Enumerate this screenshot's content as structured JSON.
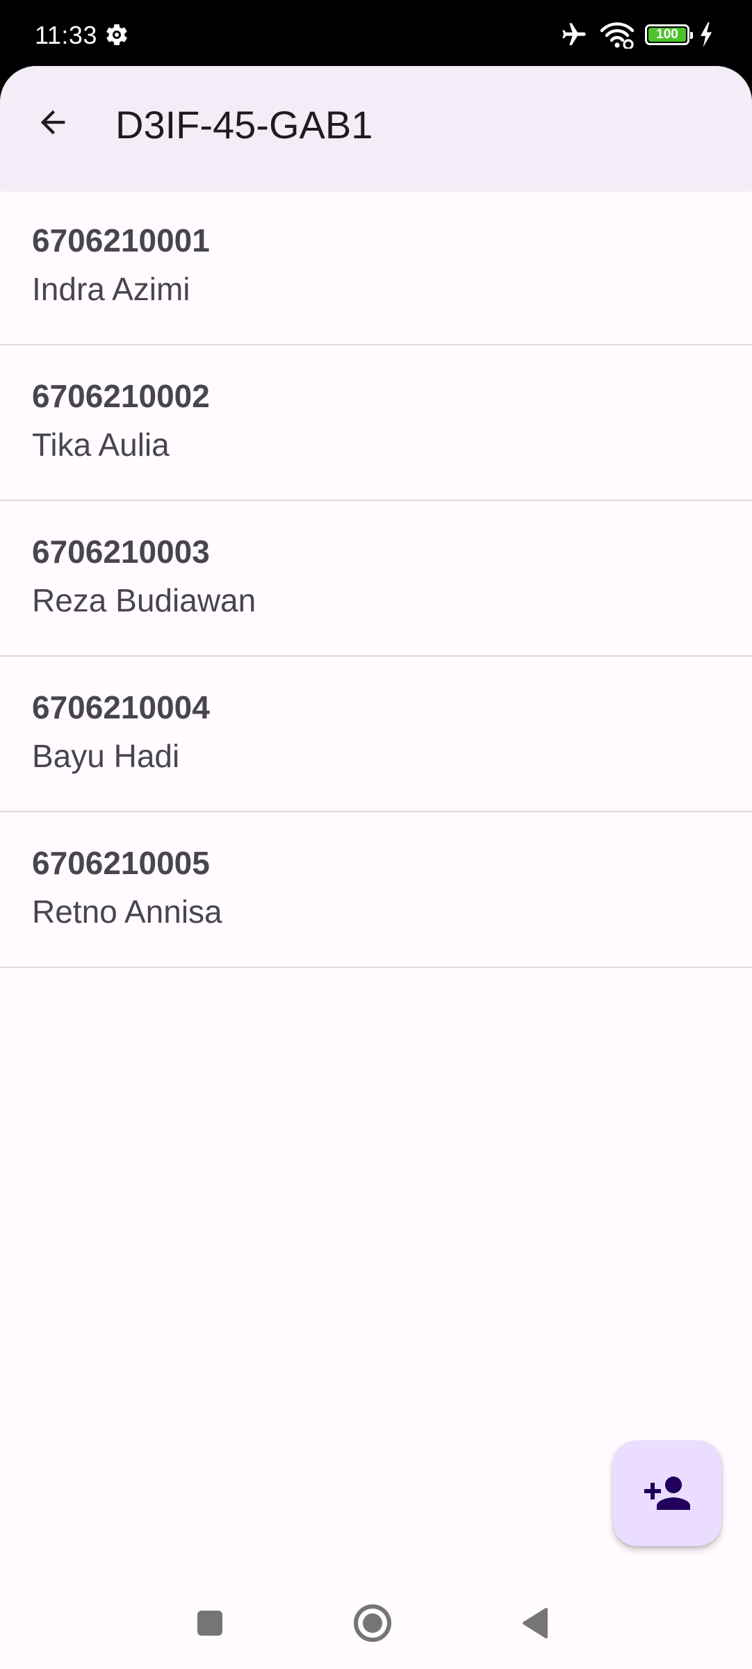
{
  "status_bar": {
    "time": "11:33",
    "battery": "100",
    "icons": [
      "settings-gear-icon",
      "airplane-mode-icon",
      "wifi-icon",
      "battery-icon",
      "charging-bolt-icon"
    ]
  },
  "app_bar": {
    "title": "D3IF-45-GAB1",
    "back_icon": "arrow-back-icon"
  },
  "students": [
    {
      "nim": "6706210001",
      "name": "Indra Azimi"
    },
    {
      "nim": "6706210002",
      "name": "Tika Aulia"
    },
    {
      "nim": "6706210003",
      "name": "Reza Budiawan"
    },
    {
      "nim": "6706210004",
      "name": "Bayu Hadi"
    },
    {
      "nim": "6706210005",
      "name": "Retno Annisa"
    }
  ],
  "fab": {
    "icon": "person-add-icon"
  },
  "nav_bar": {
    "icons": [
      "recents-square-icon",
      "home-circle-icon",
      "back-triangle-icon"
    ]
  },
  "colors": {
    "app_bar_bg": "#f3edf7",
    "background": "#fffbfe",
    "fab_bg": "#eaddff",
    "fab_icon": "#21005d",
    "text_secondary": "#49454f",
    "divider": "#dcd8dd",
    "battery_fill": "#4cc32a"
  }
}
